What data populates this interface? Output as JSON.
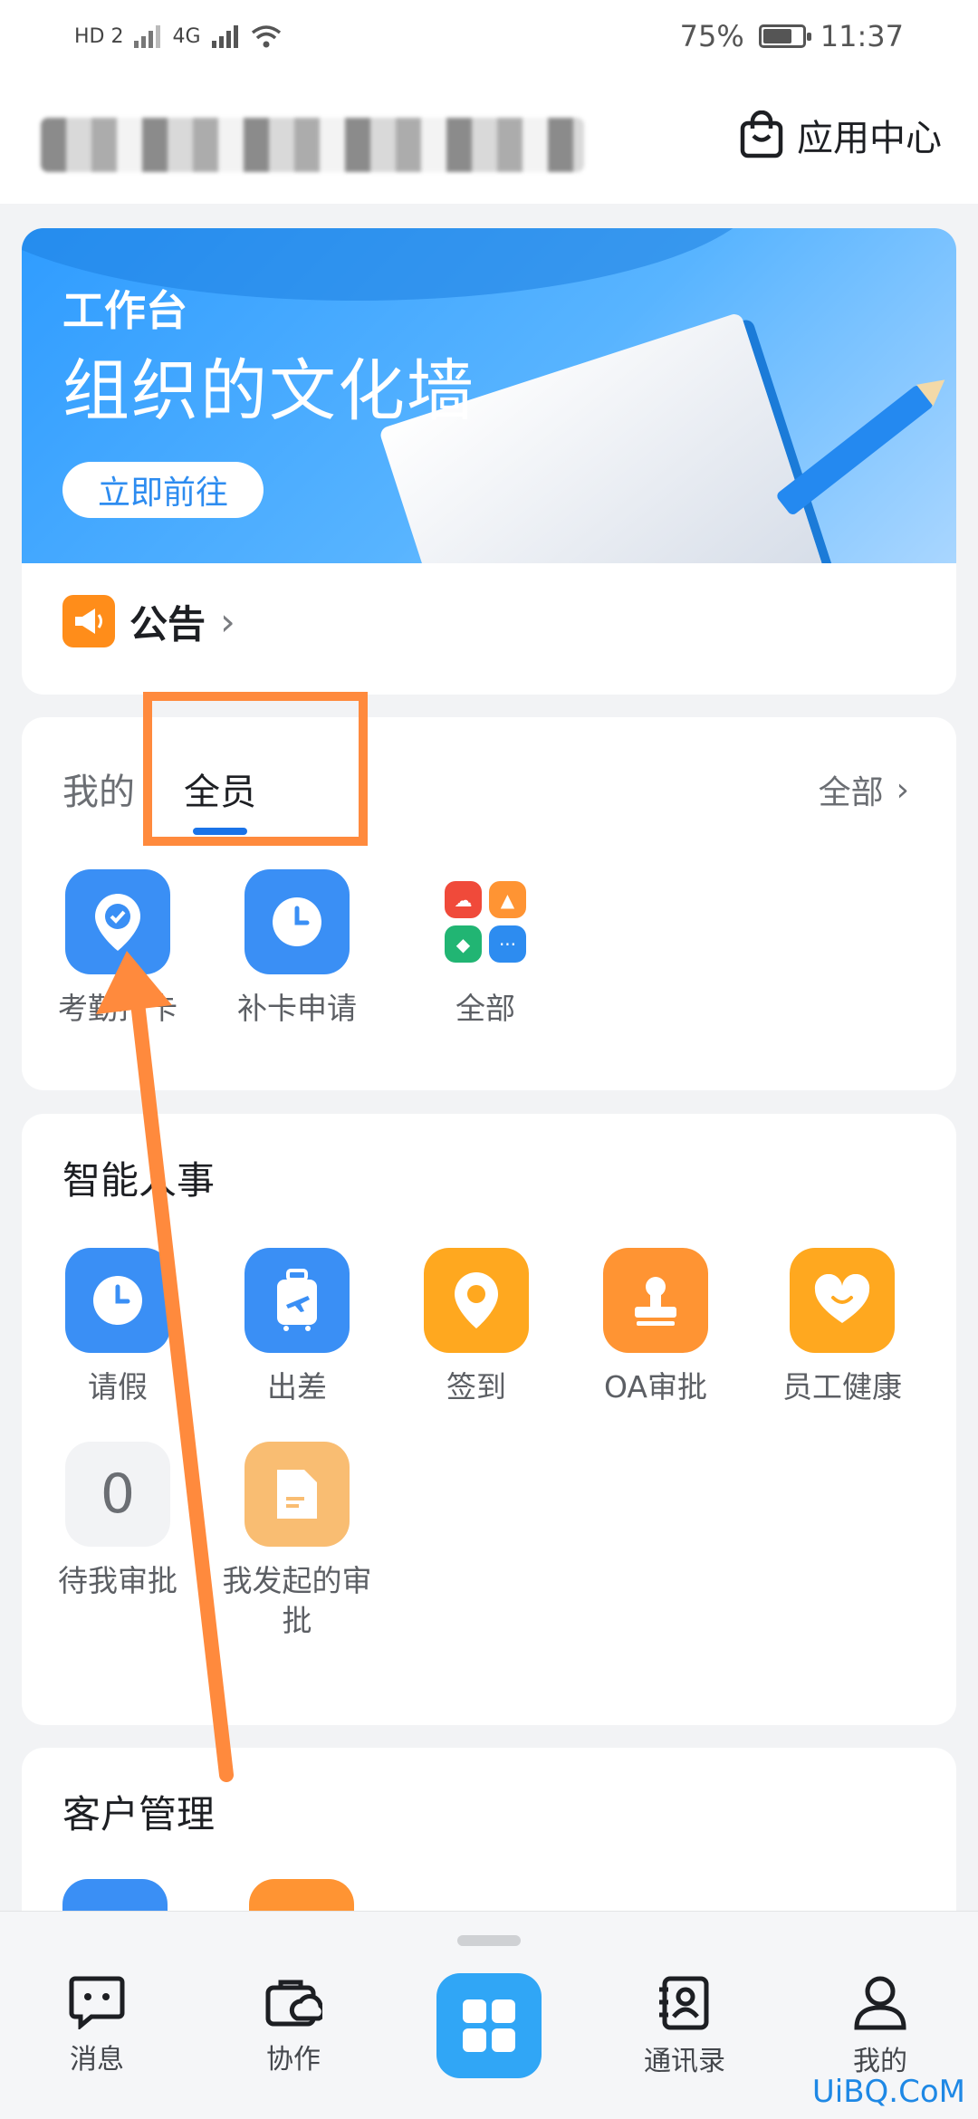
{
  "status_bar": {
    "network_left": "HD 2",
    "network_type": "4G",
    "battery_percent_text": "75%",
    "battery_level": 0.75,
    "time": "11:37"
  },
  "header": {
    "org_name": "",
    "app_center_label": "应用中心"
  },
  "banner": {
    "small_title": "工作台",
    "big_title": "组织的文化墙",
    "button_label": "立即前往"
  },
  "notice": {
    "label": "公告",
    "chevron": "›"
  },
  "quick": {
    "tabs": [
      {
        "label": "我的",
        "active": false
      },
      {
        "label": "全员",
        "active": true
      }
    ],
    "all_label": "全部",
    "chevron": "›",
    "apps": [
      {
        "label": "考勤打卡",
        "icon": "location-check-icon",
        "color": "#3a8ff5"
      },
      {
        "label": "补卡申请",
        "icon": "clock-icon",
        "color": "#3a8ff5"
      },
      {
        "label": "全部",
        "icon": "apps-grid-icon",
        "more": "···"
      }
    ]
  },
  "hr": {
    "title": "智能人事",
    "apps": [
      {
        "label": "请假",
        "icon": "clock-icon",
        "color": "#3a8ff5"
      },
      {
        "label": "出差",
        "icon": "luggage-icon",
        "color": "#3a8ff5"
      },
      {
        "label": "签到",
        "icon": "location-pin-icon",
        "color": "#ffa81f"
      },
      {
        "label": "OA审批",
        "icon": "stamp-icon",
        "color": "#ff9433"
      },
      {
        "label": "员工健康",
        "icon": "heart-icon",
        "color": "#ffa81f"
      },
      {
        "label": "待我审批",
        "icon": "count-icon",
        "value": "0"
      },
      {
        "label": "我发起的审批",
        "icon": "document-icon",
        "color": "#f9bd72"
      }
    ]
  },
  "crm": {
    "title": "客户管理"
  },
  "bottom_nav": [
    {
      "label": "消息",
      "icon": "chat-icon"
    },
    {
      "label": "协作",
      "icon": "collab-icon"
    },
    {
      "label": "",
      "icon": "workbench-grid-icon"
    },
    {
      "label": "通讯录",
      "icon": "contacts-icon"
    },
    {
      "label": "我的",
      "icon": "person-icon"
    }
  ],
  "watermark": "UiBQ.CoM",
  "annotation_color": "#ff8a3d"
}
